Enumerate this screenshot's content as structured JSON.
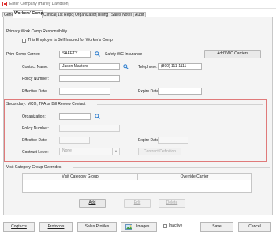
{
  "window": {
    "title": "Enter Company  (Harley Davidson)"
  },
  "tabs": [
    "General",
    "Workers' Comp",
    "Clinical",
    "1st Report",
    "Organization",
    "Billing",
    "Sales",
    "Notes",
    "Audit"
  ],
  "primary": {
    "heading": "Primary Work Comp Responsibility",
    "self_insured_label": "This Employer is Self Insured for Worker's Comp",
    "carrier_label": "Prim Comp Carrier:",
    "carrier_value": "SAFETY",
    "carrier_name": "Safety WC Insurance",
    "add_carriers": "Add'l WC Carriers",
    "contact_label": "Contact Name:",
    "contact_value": "Jason Masters",
    "telephone_label": "Telephone:",
    "telephone_value": "(800) 111-1111",
    "policy_label": "Policy Number:",
    "effective_label": "Effective Date:",
    "expire_label": "Expire Date:"
  },
  "secondary": {
    "heading": "Secondary: MCO, TPA or Bill Review Contact",
    "org_label": "Organization:",
    "policy_label": "Policy Number:",
    "effective_label": "Effective Date:",
    "expire_label": "Expire Date:",
    "contract_level_label": "Contract Level:",
    "contract_level_value": "None",
    "contract_definition": "Contract Definition"
  },
  "visit": {
    "heading": "Visit Category Group Overrides",
    "columns": [
      "Visit Category Group",
      "Override Carrier"
    ],
    "add": "Add",
    "edit": "Edit",
    "delete": "Delete"
  },
  "footer": {
    "cogtacts": "Cogtacts",
    "protocols": "Protocols",
    "sales_profiles": "Sales Profiles",
    "images": "Images",
    "inactive": "Inactive",
    "save": "Save",
    "cancel": "Cancel"
  },
  "colors": {
    "highlight_border": "#e07a7a",
    "search_icon": "#2f7fd0"
  }
}
